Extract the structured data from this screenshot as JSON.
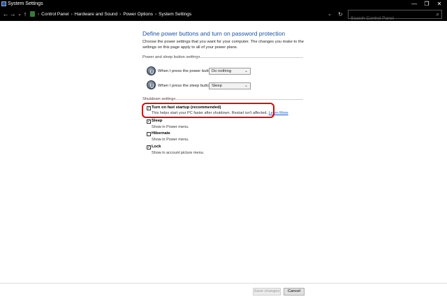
{
  "window": {
    "title": "System Settings",
    "minimize": "—",
    "maximize": "❐",
    "close": "✕"
  },
  "address": {
    "back": "←",
    "forward": "→",
    "recent": "⌄",
    "up": "↑",
    "crumbs": [
      "Control Panel",
      "Hardware and Sound",
      "Power Options",
      "System Settings"
    ],
    "dropdown": "⌄",
    "refresh": "↻",
    "search_placeholder": "Search Control Panel",
    "search_icon": "⌕"
  },
  "main": {
    "heading": "Define power buttons and turn on password protection",
    "description": "Choose the power settings that you want for your computer. The changes you make to the settings on this page apply to all of your power plans.",
    "power_section": {
      "label": "Power and sleep button settings",
      "rows": [
        {
          "label": "When I press the power button:",
          "value": "Do nothing"
        },
        {
          "label": "When I press the sleep button:",
          "value": "Sleep"
        }
      ]
    },
    "shutdown_section": {
      "label": "Shutdown settings",
      "items": [
        {
          "label": "Turn on fast startup (recommended)",
          "checked": true,
          "description": "This helps start your PC faster after shutdown. Restart isn't affected.",
          "link": "Learn More"
        },
        {
          "label": "Sleep",
          "checked": true,
          "description": "Show in Power menu."
        },
        {
          "label": "Hibernate",
          "checked": false,
          "description": "Show in Power menu."
        },
        {
          "label": "Lock",
          "checked": true,
          "description": "Show in account picture menu."
        }
      ]
    }
  },
  "footer": {
    "save_label": "Save changes",
    "cancel_label": "Cancel"
  },
  "colors": {
    "heading": "#1e4f9c",
    "highlight": "#e00000",
    "link": "#1a5fb4"
  }
}
